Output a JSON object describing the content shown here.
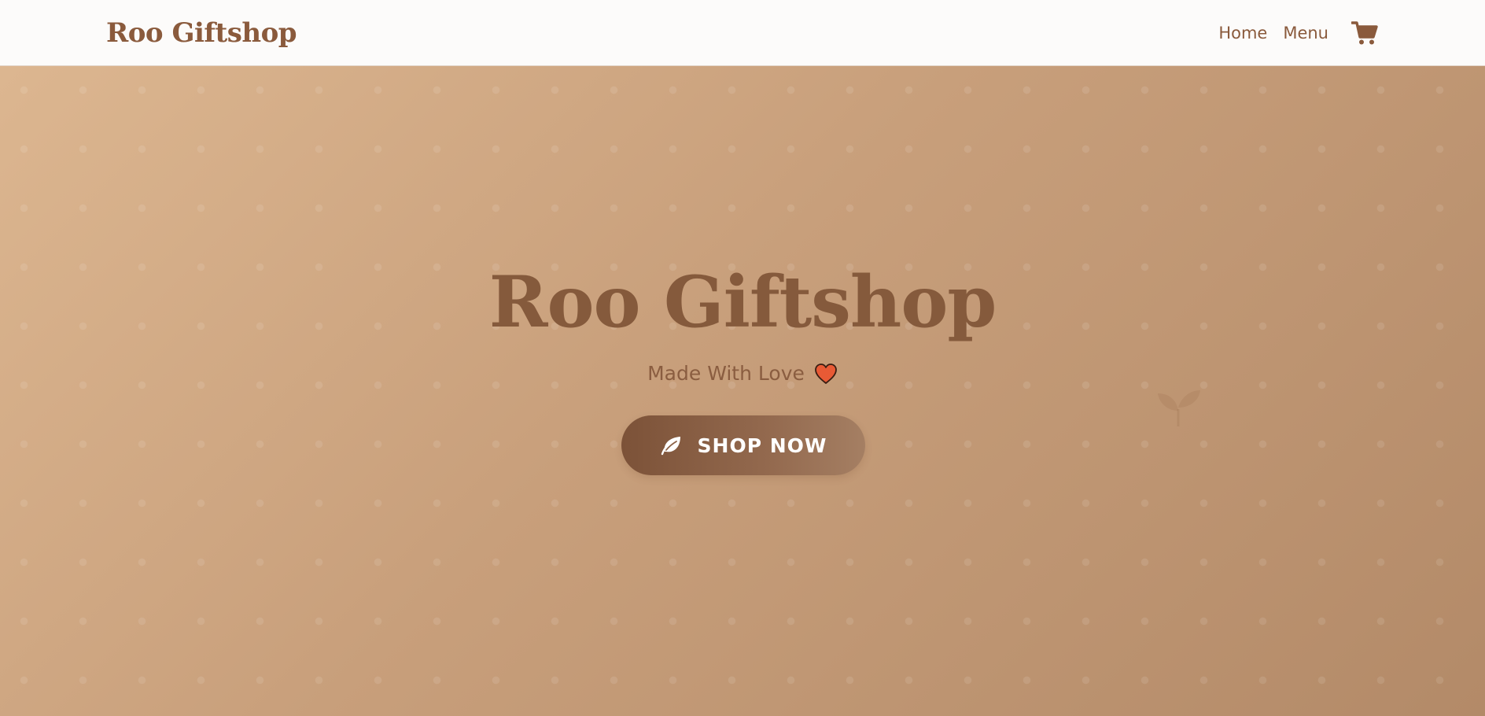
{
  "header": {
    "brand": "Roo Giftshop",
    "nav": [
      {
        "label": "Home"
      },
      {
        "label": "Menu"
      }
    ],
    "cart_icon": "cart-icon"
  },
  "hero": {
    "title": "Roo Giftshop",
    "tagline": "Made With Love",
    "tagline_icon": "heart-icon",
    "cta_label": "SHOP NOW",
    "cta_icon": "leaf-icon",
    "decor_icon": "sprout-icon"
  },
  "colors": {
    "brand_brown": "#8a5a3c",
    "header_bg": "#fcfbfa",
    "hero_gradient_start": "#dcb690",
    "hero_gradient_end": "#b38a68",
    "button_bg": "#7c5238",
    "heart": "#e85a35"
  }
}
